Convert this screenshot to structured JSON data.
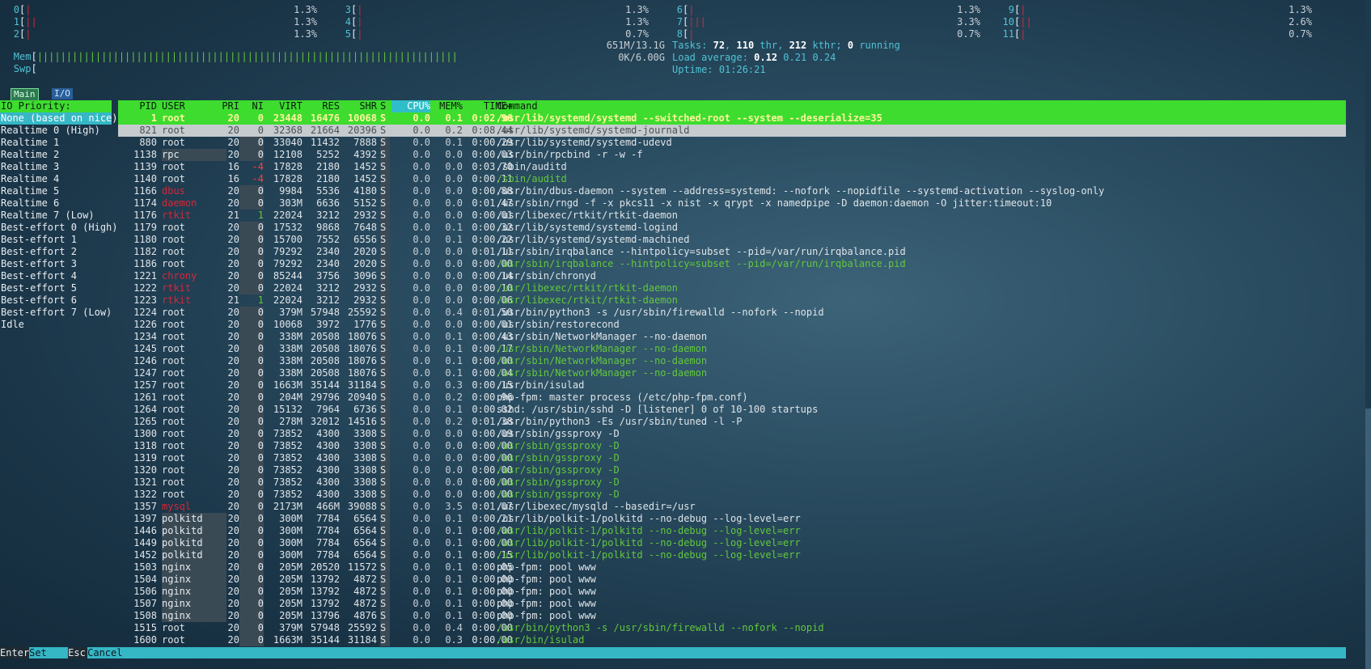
{
  "cpus": [
    {
      "id": "0",
      "bars": "|",
      "pct": "1.3%"
    },
    {
      "id": "1",
      "bars": "||",
      "pct": "1.3%"
    },
    {
      "id": "2",
      "bars": "|",
      "pct": "1.3%"
    },
    {
      "id": "3",
      "bars": "|",
      "pct": "1.3%"
    },
    {
      "id": "4",
      "bars": "|",
      "pct": "1.3%"
    },
    {
      "id": "5",
      "bars": "|",
      "pct": "0.7%"
    },
    {
      "id": "6",
      "bars": "|",
      "pct": "1.3%"
    },
    {
      "id": "7",
      "bars": "|||",
      "pct": "3.3%"
    },
    {
      "id": "8",
      "bars": "|",
      "pct": "0.7%"
    },
    {
      "id": "9",
      "bars": "|",
      "pct": "1.3%"
    },
    {
      "id": "10",
      "bars": "||",
      "pct": "2.6%"
    },
    {
      "id": "11",
      "bars": "|",
      "pct": "0.7%"
    }
  ],
  "mem": {
    "label": "Mem",
    "bars": "||||||||||||||||||||||||||||||||||||||||||||||||||||||||||||||||||||||||",
    "value": "651M/13.1G"
  },
  "swp": {
    "label": "Swp",
    "bars": "",
    "value": "0K/6.00G"
  },
  "tasks": {
    "label": "Tasks:",
    "tasks": "72",
    "thr": "110",
    "thr_label": "thr,",
    "kthr": "212",
    "kthr_label": "kthr;",
    "running": "0",
    "running_label": "running"
  },
  "load": {
    "label": "Load average:",
    "one": "0.12",
    "five": "0.21",
    "fifteen": "0.24"
  },
  "uptime": {
    "label": "Uptime:",
    "value": "01:26:21"
  },
  "tabs": {
    "main": "Main",
    "io": "I/O"
  },
  "io_panel": {
    "header": "IO Priority:",
    "items": [
      "None (based on nice)",
      "Realtime 0 (High)",
      "Realtime 1",
      "Realtime 2",
      "Realtime 3",
      "Realtime 4",
      "Realtime 5",
      "Realtime 6",
      "Realtime 7 (Low)",
      "Best-effort 0 (High)",
      "Best-effort 1",
      "Best-effort 2",
      "Best-effort 3",
      "Best-effort 4",
      "Best-effort 5",
      "Best-effort 6",
      "Best-effort 7 (Low)",
      "Idle"
    ]
  },
  "columns": {
    "pid": "PID",
    "user": "USER",
    "pri": "PRI",
    "ni": "NI",
    "virt": "VIRT",
    "res": "RES",
    "shr": "SHR",
    "s": "S",
    "cpu": "CPU%",
    "mem": "MEM%",
    "time": "TIME+",
    "cmd": "Command"
  },
  "processes": [
    {
      "pid": "1",
      "user": "root",
      "pri": "20",
      "ni": "0",
      "virt": "23448",
      "res": "16476",
      "shr": "10068",
      "s": "S",
      "cpu": "0.0",
      "mem": "0.1",
      "time": "0:02.96",
      "cmd": "/usr/lib/systemd/systemd --switched-root --system --deserialize=35"
    },
    {
      "pid": "821",
      "user": "root",
      "pri": "20",
      "ni": "0",
      "virt": "32368",
      "res": "21664",
      "shr": "20396",
      "s": "S",
      "cpu": "0.0",
      "mem": "0.2",
      "time": "0:08.44",
      "cmd": "/usr/lib/systemd/systemd-journald"
    },
    {
      "pid": "880",
      "user": "root",
      "pri": "20",
      "ni": "0",
      "virt": "33040",
      "res": "11432",
      "shr": "7888",
      "s": "S",
      "cpu": "0.0",
      "mem": "0.1",
      "time": "0:00.29",
      "cmd": "/usr/lib/systemd/systemd-udevd"
    },
    {
      "pid": "1138",
      "user": "rpc",
      "pri": "20",
      "ni": "0",
      "virt": "12108",
      "res": "5252",
      "shr": "4392",
      "s": "S",
      "cpu": "0.0",
      "mem": "0.0",
      "time": "0:00.03",
      "cmd": "/usr/bin/rpcbind -r -w -f"
    },
    {
      "pid": "1139",
      "user": "root",
      "pri": "16",
      "ni": "-4",
      "virt": "17828",
      "res": "2180",
      "shr": "1452",
      "s": "S",
      "cpu": "0.0",
      "mem": "0.0",
      "time": "0:03.70",
      "cmd": "/sbin/auditd"
    },
    {
      "pid": "1140",
      "user": "root",
      "pri": "16",
      "ni": "-4",
      "virt": "17828",
      "res": "2180",
      "shr": "1452",
      "s": "S",
      "cpu": "0.0",
      "mem": "0.0",
      "time": "0:00.11",
      "cmd": "/sbin/auditd"
    },
    {
      "pid": "1166",
      "user": "dbus",
      "pri": "20",
      "ni": "0",
      "virt": "9984",
      "res": "5536",
      "shr": "4180",
      "s": "S",
      "cpu": "0.0",
      "mem": "0.0",
      "time": "0:00.88",
      "cmd": "/usr/bin/dbus-daemon --system --address=systemd: --nofork --nopidfile --systemd-activation --syslog-only"
    },
    {
      "pid": "1174",
      "user": "daemon",
      "pri": "20",
      "ni": "0",
      "virt": "303M",
      "res": "6636",
      "shr": "5152",
      "s": "S",
      "cpu": "0.0",
      "mem": "0.0",
      "time": "0:01.47",
      "cmd": "/usr/sbin/rngd -f -x pkcs11 -x nist -x qrypt -x namedpipe -D daemon:daemon -O jitter:timeout:10"
    },
    {
      "pid": "1176",
      "user": "rtkit",
      "pri": "21",
      "ni": "1",
      "virt": "22024",
      "res": "3212",
      "shr": "2932",
      "s": "S",
      "cpu": "0.0",
      "mem": "0.0",
      "time": "0:00.01",
      "cmd": "/usr/libexec/rtkit/rtkit-daemon"
    },
    {
      "pid": "1179",
      "user": "root",
      "pri": "20",
      "ni": "0",
      "virt": "17532",
      "res": "9868",
      "shr": "7648",
      "s": "S",
      "cpu": "0.0",
      "mem": "0.1",
      "time": "0:00.32",
      "cmd": "/usr/lib/systemd/systemd-logind"
    },
    {
      "pid": "1180",
      "user": "root",
      "pri": "20",
      "ni": "0",
      "virt": "15700",
      "res": "7552",
      "shr": "6556",
      "s": "S",
      "cpu": "0.0",
      "mem": "0.1",
      "time": "0:00.22",
      "cmd": "/usr/lib/systemd/systemd-machined"
    },
    {
      "pid": "1182",
      "user": "root",
      "pri": "20",
      "ni": "0",
      "virt": "79292",
      "res": "2340",
      "shr": "2020",
      "s": "S",
      "cpu": "0.0",
      "mem": "0.0",
      "time": "0:01.11",
      "cmd": "/usr/sbin/irqbalance --hintpolicy=subset --pid=/var/run/irqbalance.pid"
    },
    {
      "pid": "1186",
      "user": "root",
      "pri": "20",
      "ni": "0",
      "virt": "79292",
      "res": "2340",
      "shr": "2020",
      "s": "S",
      "cpu": "0.0",
      "mem": "0.0",
      "time": "0:00.00",
      "cmd": "/usr/sbin/irqbalance --hintpolicy=subset --pid=/var/run/irqbalance.pid"
    },
    {
      "pid": "1221",
      "user": "chrony",
      "pri": "20",
      "ni": "0",
      "virt": "85244",
      "res": "3756",
      "shr": "3096",
      "s": "S",
      "cpu": "0.0",
      "mem": "0.0",
      "time": "0:00.14",
      "cmd": "/usr/sbin/chronyd"
    },
    {
      "pid": "1222",
      "user": "rtkit",
      "pri": "20",
      "ni": "0",
      "virt": "22024",
      "res": "3212",
      "shr": "2932",
      "s": "S",
      "cpu": "0.0",
      "mem": "0.0",
      "time": "0:00.10",
      "cmd": "/usr/libexec/rtkit/rtkit-daemon"
    },
    {
      "pid": "1223",
      "user": "rtkit",
      "pri": "21",
      "ni": "1",
      "virt": "22024",
      "res": "3212",
      "shr": "2932",
      "s": "S",
      "cpu": "0.0",
      "mem": "0.0",
      "time": "0:00.06",
      "cmd": "/usr/libexec/rtkit/rtkit-daemon"
    },
    {
      "pid": "1224",
      "user": "root",
      "pri": "20",
      "ni": "0",
      "virt": "379M",
      "res": "57948",
      "shr": "25592",
      "s": "S",
      "cpu": "0.0",
      "mem": "0.4",
      "time": "0:01.50",
      "cmd": "/usr/bin/python3 -s /usr/sbin/firewalld --nofork --nopid"
    },
    {
      "pid": "1226",
      "user": "root",
      "pri": "20",
      "ni": "0",
      "virt": "10068",
      "res": "3972",
      "shr": "1776",
      "s": "S",
      "cpu": "0.0",
      "mem": "0.0",
      "time": "0:00.01",
      "cmd": "/usr/sbin/restorecond"
    },
    {
      "pid": "1234",
      "user": "root",
      "pri": "20",
      "ni": "0",
      "virt": "338M",
      "res": "20508",
      "shr": "18076",
      "s": "S",
      "cpu": "0.0",
      "mem": "0.1",
      "time": "0:00.43",
      "cmd": "/usr/sbin/NetworkManager --no-daemon"
    },
    {
      "pid": "1245",
      "user": "root",
      "pri": "20",
      "ni": "0",
      "virt": "338M",
      "res": "20508",
      "shr": "18076",
      "s": "S",
      "cpu": "0.0",
      "mem": "0.1",
      "time": "0:00.17",
      "cmd": "/usr/sbin/NetworkManager --no-daemon"
    },
    {
      "pid": "1246",
      "user": "root",
      "pri": "20",
      "ni": "0",
      "virt": "338M",
      "res": "20508",
      "shr": "18076",
      "s": "S",
      "cpu": "0.0",
      "mem": "0.1",
      "time": "0:00.00",
      "cmd": "/usr/sbin/NetworkManager --no-daemon"
    },
    {
      "pid": "1247",
      "user": "root",
      "pri": "20",
      "ni": "0",
      "virt": "338M",
      "res": "20508",
      "shr": "18076",
      "s": "S",
      "cpu": "0.0",
      "mem": "0.1",
      "time": "0:00.04",
      "cmd": "/usr/sbin/NetworkManager --no-daemon"
    },
    {
      "pid": "1257",
      "user": "root",
      "pri": "20",
      "ni": "0",
      "virt": "1663M",
      "res": "35144",
      "shr": "31184",
      "s": "S",
      "cpu": "0.0",
      "mem": "0.3",
      "time": "0:00.15",
      "cmd": "/usr/bin/isulad"
    },
    {
      "pid": "1261",
      "user": "root",
      "pri": "20",
      "ni": "0",
      "virt": "204M",
      "res": "29796",
      "shr": "20940",
      "s": "S",
      "cpu": "0.0",
      "mem": "0.2",
      "time": "0:00.96",
      "cmd": "php-fpm: master process (/etc/php-fpm.conf)"
    },
    {
      "pid": "1264",
      "user": "root",
      "pri": "20",
      "ni": "0",
      "virt": "15132",
      "res": "7964",
      "shr": "6736",
      "s": "S",
      "cpu": "0.0",
      "mem": "0.1",
      "time": "0:00.02",
      "cmd": "sshd: /usr/sbin/sshd -D [listener] 0 of 10-100 startups"
    },
    {
      "pid": "1265",
      "user": "root",
      "pri": "20",
      "ni": "0",
      "virt": "278M",
      "res": "32012",
      "shr": "14516",
      "s": "S",
      "cpu": "0.0",
      "mem": "0.2",
      "time": "0:01.38",
      "cmd": "/usr/bin/python3 -Es /usr/sbin/tuned -l -P"
    },
    {
      "pid": "1300",
      "user": "root",
      "pri": "20",
      "ni": "0",
      "virt": "73852",
      "res": "4300",
      "shr": "3308",
      "s": "S",
      "cpu": "0.0",
      "mem": "0.0",
      "time": "0:00.09",
      "cmd": "/usr/sbin/gssproxy -D"
    },
    {
      "pid": "1318",
      "user": "root",
      "pri": "20",
      "ni": "0",
      "virt": "73852",
      "res": "4300",
      "shr": "3308",
      "s": "S",
      "cpu": "0.0",
      "mem": "0.0",
      "time": "0:00.00",
      "cmd": "/usr/sbin/gssproxy -D"
    },
    {
      "pid": "1319",
      "user": "root",
      "pri": "20",
      "ni": "0",
      "virt": "73852",
      "res": "4300",
      "shr": "3308",
      "s": "S",
      "cpu": "0.0",
      "mem": "0.0",
      "time": "0:00.00",
      "cmd": "/usr/sbin/gssproxy -D"
    },
    {
      "pid": "1320",
      "user": "root",
      "pri": "20",
      "ni": "0",
      "virt": "73852",
      "res": "4300",
      "shr": "3308",
      "s": "S",
      "cpu": "0.0",
      "mem": "0.0",
      "time": "0:00.00",
      "cmd": "/usr/sbin/gssproxy -D"
    },
    {
      "pid": "1321",
      "user": "root",
      "pri": "20",
      "ni": "0",
      "virt": "73852",
      "res": "4300",
      "shr": "3308",
      "s": "S",
      "cpu": "0.0",
      "mem": "0.0",
      "time": "0:00.00",
      "cmd": "/usr/sbin/gssproxy -D"
    },
    {
      "pid": "1322",
      "user": "root",
      "pri": "20",
      "ni": "0",
      "virt": "73852",
      "res": "4300",
      "shr": "3308",
      "s": "S",
      "cpu": "0.0",
      "mem": "0.0",
      "time": "0:00.00",
      "cmd": "/usr/sbin/gssproxy -D"
    },
    {
      "pid": "1357",
      "user": "mysql",
      "pri": "20",
      "ni": "0",
      "virt": "2173M",
      "res": "466M",
      "shr": "39088",
      "s": "S",
      "cpu": "0.0",
      "mem": "3.5",
      "time": "0:01.07",
      "cmd": "/usr/libexec/mysqld --basedir=/usr"
    },
    {
      "pid": "1397",
      "user": "polkitd",
      "pri": "20",
      "ni": "0",
      "virt": "300M",
      "res": "7784",
      "shr": "6564",
      "s": "S",
      "cpu": "0.0",
      "mem": "0.1",
      "time": "0:00.21",
      "cmd": "/usr/lib/polkit-1/polkitd --no-debug --log-level=err"
    },
    {
      "pid": "1446",
      "user": "polkitd",
      "pri": "20",
      "ni": "0",
      "virt": "300M",
      "res": "7784",
      "shr": "6564",
      "s": "S",
      "cpu": "0.0",
      "mem": "0.1",
      "time": "0:00.00",
      "cmd": "/usr/lib/polkit-1/polkitd --no-debug --log-level=err"
    },
    {
      "pid": "1449",
      "user": "polkitd",
      "pri": "20",
      "ni": "0",
      "virt": "300M",
      "res": "7784",
      "shr": "6564",
      "s": "S",
      "cpu": "0.0",
      "mem": "0.1",
      "time": "0:00.00",
      "cmd": "/usr/lib/polkit-1/polkitd --no-debug --log-level=err"
    },
    {
      "pid": "1452",
      "user": "polkitd",
      "pri": "20",
      "ni": "0",
      "virt": "300M",
      "res": "7784",
      "shr": "6564",
      "s": "S",
      "cpu": "0.0",
      "mem": "0.1",
      "time": "0:00.15",
      "cmd": "/usr/lib/polkit-1/polkitd --no-debug --log-level=err"
    },
    {
      "pid": "1503",
      "user": "nginx",
      "pri": "20",
      "ni": "0",
      "virt": "205M",
      "res": "20520",
      "shr": "11572",
      "s": "S",
      "cpu": "0.0",
      "mem": "0.1",
      "time": "0:00.05",
      "cmd": "php-fpm: pool www"
    },
    {
      "pid": "1504",
      "user": "nginx",
      "pri": "20",
      "ni": "0",
      "virt": "205M",
      "res": "13792",
      "shr": "4872",
      "s": "S",
      "cpu": "0.0",
      "mem": "0.1",
      "time": "0:00.00",
      "cmd": "php-fpm: pool www"
    },
    {
      "pid": "1506",
      "user": "nginx",
      "pri": "20",
      "ni": "0",
      "virt": "205M",
      "res": "13792",
      "shr": "4872",
      "s": "S",
      "cpu": "0.0",
      "mem": "0.1",
      "time": "0:00.00",
      "cmd": "php-fpm: pool www"
    },
    {
      "pid": "1507",
      "user": "nginx",
      "pri": "20",
      "ni": "0",
      "virt": "205M",
      "res": "13792",
      "shr": "4872",
      "s": "S",
      "cpu": "0.0",
      "mem": "0.1",
      "time": "0:00.00",
      "cmd": "php-fpm: pool www"
    },
    {
      "pid": "1508",
      "user": "nginx",
      "pri": "20",
      "ni": "0",
      "virt": "205M",
      "res": "13796",
      "shr": "4876",
      "s": "S",
      "cpu": "0.0",
      "mem": "0.1",
      "time": "0:00.00",
      "cmd": "php-fpm: pool www"
    },
    {
      "pid": "1515",
      "user": "root",
      "pri": "20",
      "ni": "0",
      "virt": "379M",
      "res": "57948",
      "shr": "25592",
      "s": "S",
      "cpu": "0.0",
      "mem": "0.4",
      "time": "0:00.00",
      "cmd": "/usr/bin/python3 -s /usr/sbin/firewalld --nofork --nopid"
    },
    {
      "pid": "1600",
      "user": "root",
      "pri": "20",
      "ni": "0",
      "virt": "1663M",
      "res": "35144",
      "shr": "31184",
      "s": "S",
      "cpu": "0.0",
      "mem": "0.3",
      "time": "0:00.00",
      "cmd": "/usr/bin/isulad"
    }
  ],
  "footer": {
    "enter_key": "Enter",
    "enter_label": "Set",
    "esc_key": "Esc",
    "esc_label": "Cancel"
  },
  "colors": {
    "header_bg": "#3ddc2f",
    "footer_bg": "#35b7c6",
    "accent_cyan": "#4fc3d4",
    "user_red": "#d1283a"
  }
}
